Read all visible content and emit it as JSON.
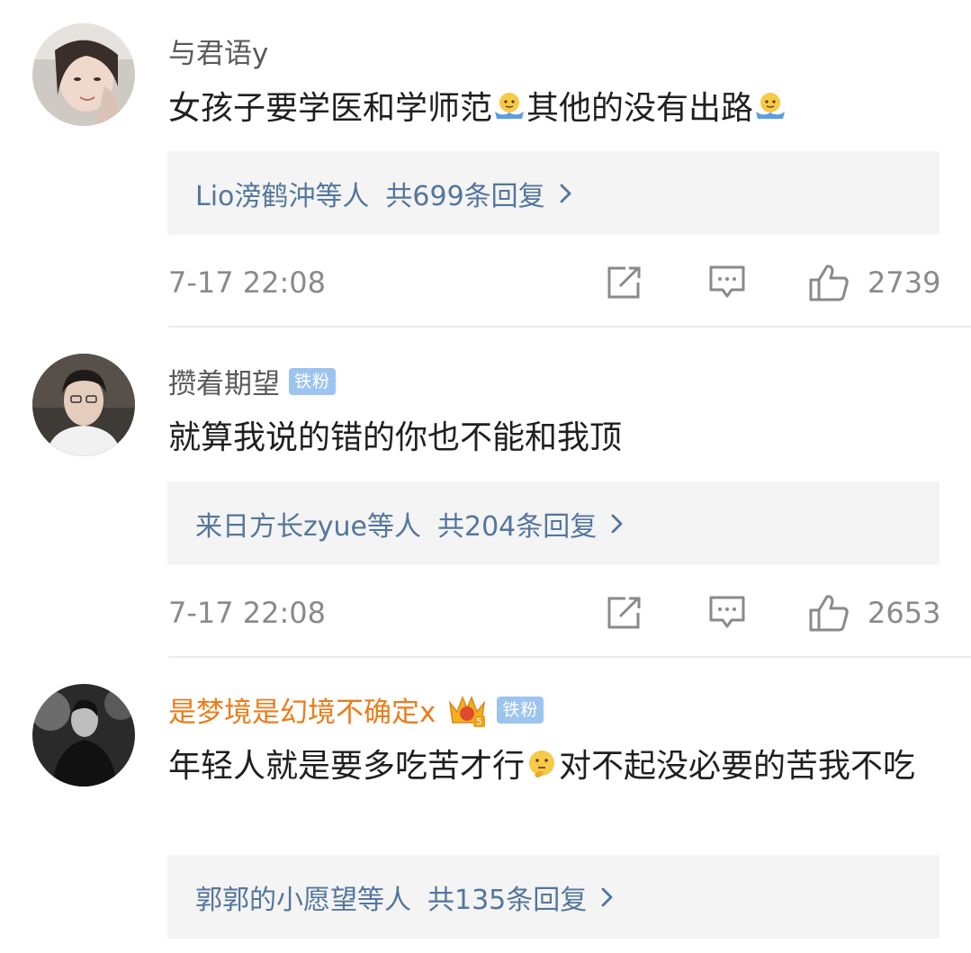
{
  "comments": [
    {
      "username": "与君语y",
      "badge": "",
      "text_parts": [
        "女孩子要学医和学师范",
        "其他的没有出路",
        ""
      ],
      "replies_users": "Lio滂鹤沖等人",
      "replies_count": "共699条回复",
      "time": "7-17 22:08",
      "likes": "2739"
    },
    {
      "username": "攒着期望",
      "badge": "铁粉",
      "text": "就算我说的错的你也不能和我顶",
      "replies_users": "来日方长zyue等人",
      "replies_count": "共204条回复",
      "time": "7-17 22:08",
      "likes": "2653"
    },
    {
      "username": "是梦境是幻境不确定x",
      "badge": "铁粉",
      "text_parts": [
        "年轻人就是要多吃苦才行",
        "对不起没必要的苦我不吃"
      ],
      "replies_users": "郭郭的小愿望等人",
      "replies_count": "共135条回复"
    }
  ],
  "icons": {
    "share": "share-icon",
    "comment": "comment-icon",
    "like": "thumbs-up-icon",
    "chevron": "chevron-right-icon",
    "emoji_shrug": "shrug-emoji-icon",
    "emoji_think": "thinking-emoji-icon",
    "crown": "vip-crown-icon"
  },
  "colors": {
    "username": "#5a5a5a",
    "vip_username": "#eb7c1b",
    "reply_link": "#53769c",
    "badge_bg": "#9cc4ef",
    "reply_box_bg": "#f4f4f4",
    "meta_text": "#8a8a8a"
  }
}
